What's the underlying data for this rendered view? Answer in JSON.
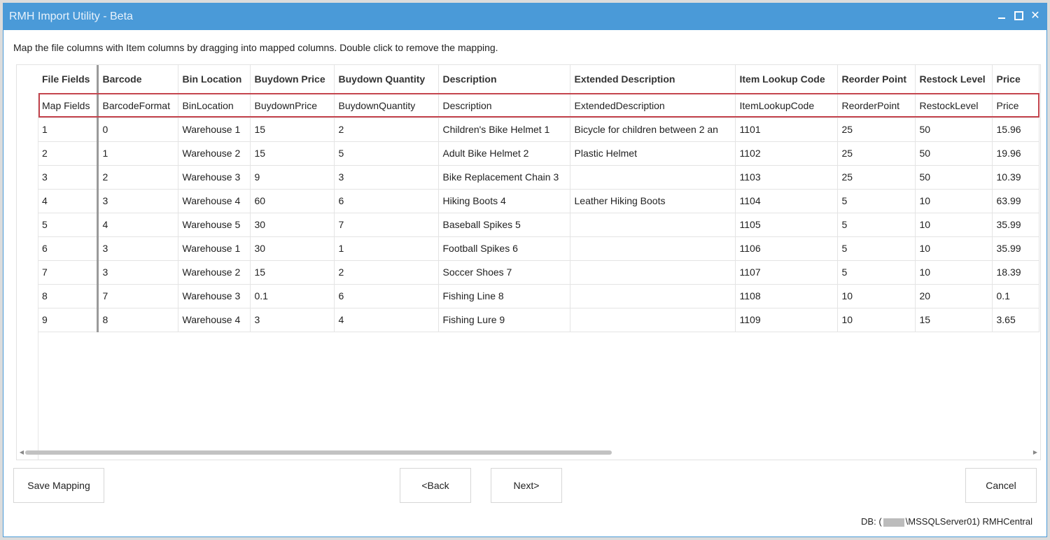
{
  "window": {
    "title": "RMH Import Utility - Beta",
    "controls": {
      "minimize": "minimize",
      "maximize": "maximize",
      "close": "✕"
    }
  },
  "instructions": "Map the file columns with Item columns by dragging into mapped columns. Double click to remove the mapping.",
  "grid": {
    "columns": [
      "File Fields",
      "Barcode",
      "Bin Location",
      "Buydown Price",
      "Buydown Quantity",
      "Description",
      "Extended Description",
      "Item Lookup Code",
      "Reorder Point",
      "Restock Level",
      "Price"
    ],
    "map_row": [
      "Map Fields",
      "BarcodeFormat",
      "BinLocation",
      "BuydownPrice",
      "BuydownQuantity",
      "Description",
      "ExtendedDescription",
      "ItemLookupCode",
      "ReorderPoint",
      "RestockLevel",
      "Price"
    ],
    "rows": [
      [
        "1",
        "0",
        "Warehouse 1",
        "15",
        "2",
        "Children's Bike Helmet 1",
        "Bicycle for children between 2 an",
        "1101",
        "25",
        "50",
        "15.96"
      ],
      [
        "2",
        "1",
        "Warehouse 2",
        "15",
        "5",
        "Adult Bike Helmet 2",
        "Plastic Helmet",
        "1102",
        "25",
        "50",
        "19.96"
      ],
      [
        "3",
        "2",
        "Warehouse 3",
        "9",
        "3",
        "Bike Replacement Chain 3",
        "",
        "1103",
        "25",
        "50",
        "10.39"
      ],
      [
        "4",
        "3",
        "Warehouse 4",
        "60",
        "6",
        "Hiking Boots 4",
        "Leather Hiking Boots",
        "1104",
        "5",
        "10",
        "63.99"
      ],
      [
        "5",
        "4",
        "Warehouse 5",
        "30",
        "7",
        "Baseball Spikes 5",
        "",
        "1105",
        "5",
        "10",
        "35.99"
      ],
      [
        "6",
        "3",
        "Warehouse 1",
        "30",
        "1",
        "Football Spikes 6",
        "",
        "1106",
        "5",
        "10",
        "35.99"
      ],
      [
        "7",
        "3",
        "Warehouse 2",
        "15",
        "2",
        "Soccer Shoes 7",
        "",
        "1107",
        "5",
        "10",
        "18.39"
      ],
      [
        "8",
        "7",
        "Warehouse 3",
        "0.1",
        "6",
        "Fishing Line 8",
        "",
        "1108",
        "10",
        "20",
        "0.1"
      ],
      [
        "9",
        "8",
        "Warehouse 4",
        "3",
        "4",
        "Fishing Lure 9",
        "",
        "1109",
        "10",
        "15",
        "3.65"
      ]
    ]
  },
  "buttons": {
    "save_mapping": "Save Mapping",
    "back": "<Back",
    "next": "Next>",
    "cancel": "Cancel"
  },
  "status": {
    "prefix": "DB: (",
    "suffix": "\\MSSQLServer01) RMHCentral"
  },
  "colors": {
    "titlebar": "#4a9ad8",
    "map_row_outline": "#c4454e"
  }
}
